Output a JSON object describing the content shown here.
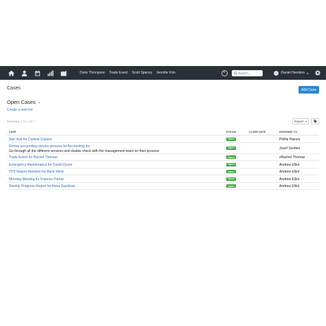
{
  "topbar": {
    "nav_icons": [
      "home-icon",
      "person-icon",
      "calendar-icon",
      "bar-chart-icon",
      "building-icon"
    ],
    "recent_items": [
      "Doris Thompson",
      "Trade Event",
      "Scott Spacey",
      "Jennifer Kim"
    ],
    "search_placeholder": "Search...",
    "user_name": "Daniel Henders",
    "colors": {
      "background": "#2b2f36",
      "text": "#e6e8ea"
    }
  },
  "page": {
    "title": "Cases",
    "add_button": "Add Case",
    "list_title": "Open Cases",
    "create_link": "Create a new list",
    "showing": "SHOWING 1 TO 7 OF 7",
    "export_label": "Export",
    "accent_color": "#2e86d1"
  },
  "table": {
    "headers": {
      "case": "CASE",
      "status": "STATUS",
      "close_date": "CLOSE DATE",
      "assigned_to": "ASSIGNED TO"
    },
    "rows": [
      {
        "case": "Site Visit for Central Copiers",
        "description": "",
        "status": "Open",
        "close_date": "",
        "assigned_to": "Phillip Haines"
      },
      {
        "case": "Revise accounting service process for Accounting Inc",
        "description": "Go through all the different services and double check with the management team on their process",
        "status": "Open",
        "close_date": "",
        "assigned_to": "Josef Scotten"
      },
      {
        "case": "Trade Event for Rachel Thomas",
        "description": "",
        "status": "Open",
        "close_date": "",
        "assigned_to": "zRachel Thomas"
      },
      {
        "case": "Emergency Maintenance for David Dyson",
        "description": "",
        "status": "Open",
        "close_date": "",
        "assigned_to": "Andrew Elliot"
      },
      {
        "case": "TPS Report Revision for Bank West",
        "description": "",
        "status": "Open",
        "close_date": "",
        "assigned_to": "Andrew Elliot"
      },
      {
        "case": "Morning Meeting for Frances Parker",
        "description": "",
        "status": "Open",
        "close_date": "",
        "assigned_to": "Andrew Elliot"
      },
      {
        "case": "Weekly Progress Report for Anna Davidson",
        "description": "",
        "status": "Open",
        "close_date": "",
        "assigned_to": "Andrew Elliot"
      }
    ],
    "status_color": "#3ca53c"
  }
}
